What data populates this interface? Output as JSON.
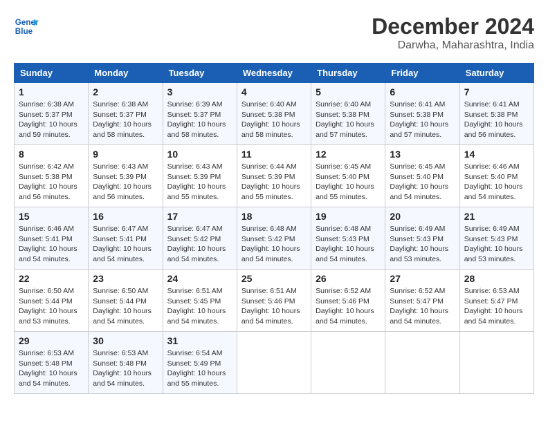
{
  "logo": {
    "line1": "General",
    "line2": "Blue"
  },
  "title": "December 2024",
  "subtitle": "Darwha, Maharashtra, India",
  "days_of_week": [
    "Sunday",
    "Monday",
    "Tuesday",
    "Wednesday",
    "Thursday",
    "Friday",
    "Saturday"
  ],
  "weeks": [
    [
      {
        "day": 1,
        "info": "Sunrise: 6:38 AM\nSunset: 5:37 PM\nDaylight: 10 hours\nand 59 minutes."
      },
      {
        "day": 2,
        "info": "Sunrise: 6:38 AM\nSunset: 5:37 PM\nDaylight: 10 hours\nand 58 minutes."
      },
      {
        "day": 3,
        "info": "Sunrise: 6:39 AM\nSunset: 5:37 PM\nDaylight: 10 hours\nand 58 minutes."
      },
      {
        "day": 4,
        "info": "Sunrise: 6:40 AM\nSunset: 5:38 PM\nDaylight: 10 hours\nand 58 minutes."
      },
      {
        "day": 5,
        "info": "Sunrise: 6:40 AM\nSunset: 5:38 PM\nDaylight: 10 hours\nand 57 minutes."
      },
      {
        "day": 6,
        "info": "Sunrise: 6:41 AM\nSunset: 5:38 PM\nDaylight: 10 hours\nand 57 minutes."
      },
      {
        "day": 7,
        "info": "Sunrise: 6:41 AM\nSunset: 5:38 PM\nDaylight: 10 hours\nand 56 minutes."
      }
    ],
    [
      {
        "day": 8,
        "info": "Sunrise: 6:42 AM\nSunset: 5:38 PM\nDaylight: 10 hours\nand 56 minutes."
      },
      {
        "day": 9,
        "info": "Sunrise: 6:43 AM\nSunset: 5:39 PM\nDaylight: 10 hours\nand 56 minutes."
      },
      {
        "day": 10,
        "info": "Sunrise: 6:43 AM\nSunset: 5:39 PM\nDaylight: 10 hours\nand 55 minutes."
      },
      {
        "day": 11,
        "info": "Sunrise: 6:44 AM\nSunset: 5:39 PM\nDaylight: 10 hours\nand 55 minutes."
      },
      {
        "day": 12,
        "info": "Sunrise: 6:45 AM\nSunset: 5:40 PM\nDaylight: 10 hours\nand 55 minutes."
      },
      {
        "day": 13,
        "info": "Sunrise: 6:45 AM\nSunset: 5:40 PM\nDaylight: 10 hours\nand 54 minutes."
      },
      {
        "day": 14,
        "info": "Sunrise: 6:46 AM\nSunset: 5:40 PM\nDaylight: 10 hours\nand 54 minutes."
      }
    ],
    [
      {
        "day": 15,
        "info": "Sunrise: 6:46 AM\nSunset: 5:41 PM\nDaylight: 10 hours\nand 54 minutes."
      },
      {
        "day": 16,
        "info": "Sunrise: 6:47 AM\nSunset: 5:41 PM\nDaylight: 10 hours\nand 54 minutes."
      },
      {
        "day": 17,
        "info": "Sunrise: 6:47 AM\nSunset: 5:42 PM\nDaylight: 10 hours\nand 54 minutes."
      },
      {
        "day": 18,
        "info": "Sunrise: 6:48 AM\nSunset: 5:42 PM\nDaylight: 10 hours\nand 54 minutes."
      },
      {
        "day": 19,
        "info": "Sunrise: 6:48 AM\nSunset: 5:43 PM\nDaylight: 10 hours\nand 54 minutes."
      },
      {
        "day": 20,
        "info": "Sunrise: 6:49 AM\nSunset: 5:43 PM\nDaylight: 10 hours\nand 53 minutes."
      },
      {
        "day": 21,
        "info": "Sunrise: 6:49 AM\nSunset: 5:43 PM\nDaylight: 10 hours\nand 53 minutes."
      }
    ],
    [
      {
        "day": 22,
        "info": "Sunrise: 6:50 AM\nSunset: 5:44 PM\nDaylight: 10 hours\nand 53 minutes."
      },
      {
        "day": 23,
        "info": "Sunrise: 6:50 AM\nSunset: 5:44 PM\nDaylight: 10 hours\nand 54 minutes."
      },
      {
        "day": 24,
        "info": "Sunrise: 6:51 AM\nSunset: 5:45 PM\nDaylight: 10 hours\nand 54 minutes."
      },
      {
        "day": 25,
        "info": "Sunrise: 6:51 AM\nSunset: 5:46 PM\nDaylight: 10 hours\nand 54 minutes."
      },
      {
        "day": 26,
        "info": "Sunrise: 6:52 AM\nSunset: 5:46 PM\nDaylight: 10 hours\nand 54 minutes."
      },
      {
        "day": 27,
        "info": "Sunrise: 6:52 AM\nSunset: 5:47 PM\nDaylight: 10 hours\nand 54 minutes."
      },
      {
        "day": 28,
        "info": "Sunrise: 6:53 AM\nSunset: 5:47 PM\nDaylight: 10 hours\nand 54 minutes."
      }
    ],
    [
      {
        "day": 29,
        "info": "Sunrise: 6:53 AM\nSunset: 5:48 PM\nDaylight: 10 hours\nand 54 minutes."
      },
      {
        "day": 30,
        "info": "Sunrise: 6:53 AM\nSunset: 5:48 PM\nDaylight: 10 hours\nand 54 minutes."
      },
      {
        "day": 31,
        "info": "Sunrise: 6:54 AM\nSunset: 5:49 PM\nDaylight: 10 hours\nand 55 minutes."
      },
      null,
      null,
      null,
      null
    ]
  ]
}
